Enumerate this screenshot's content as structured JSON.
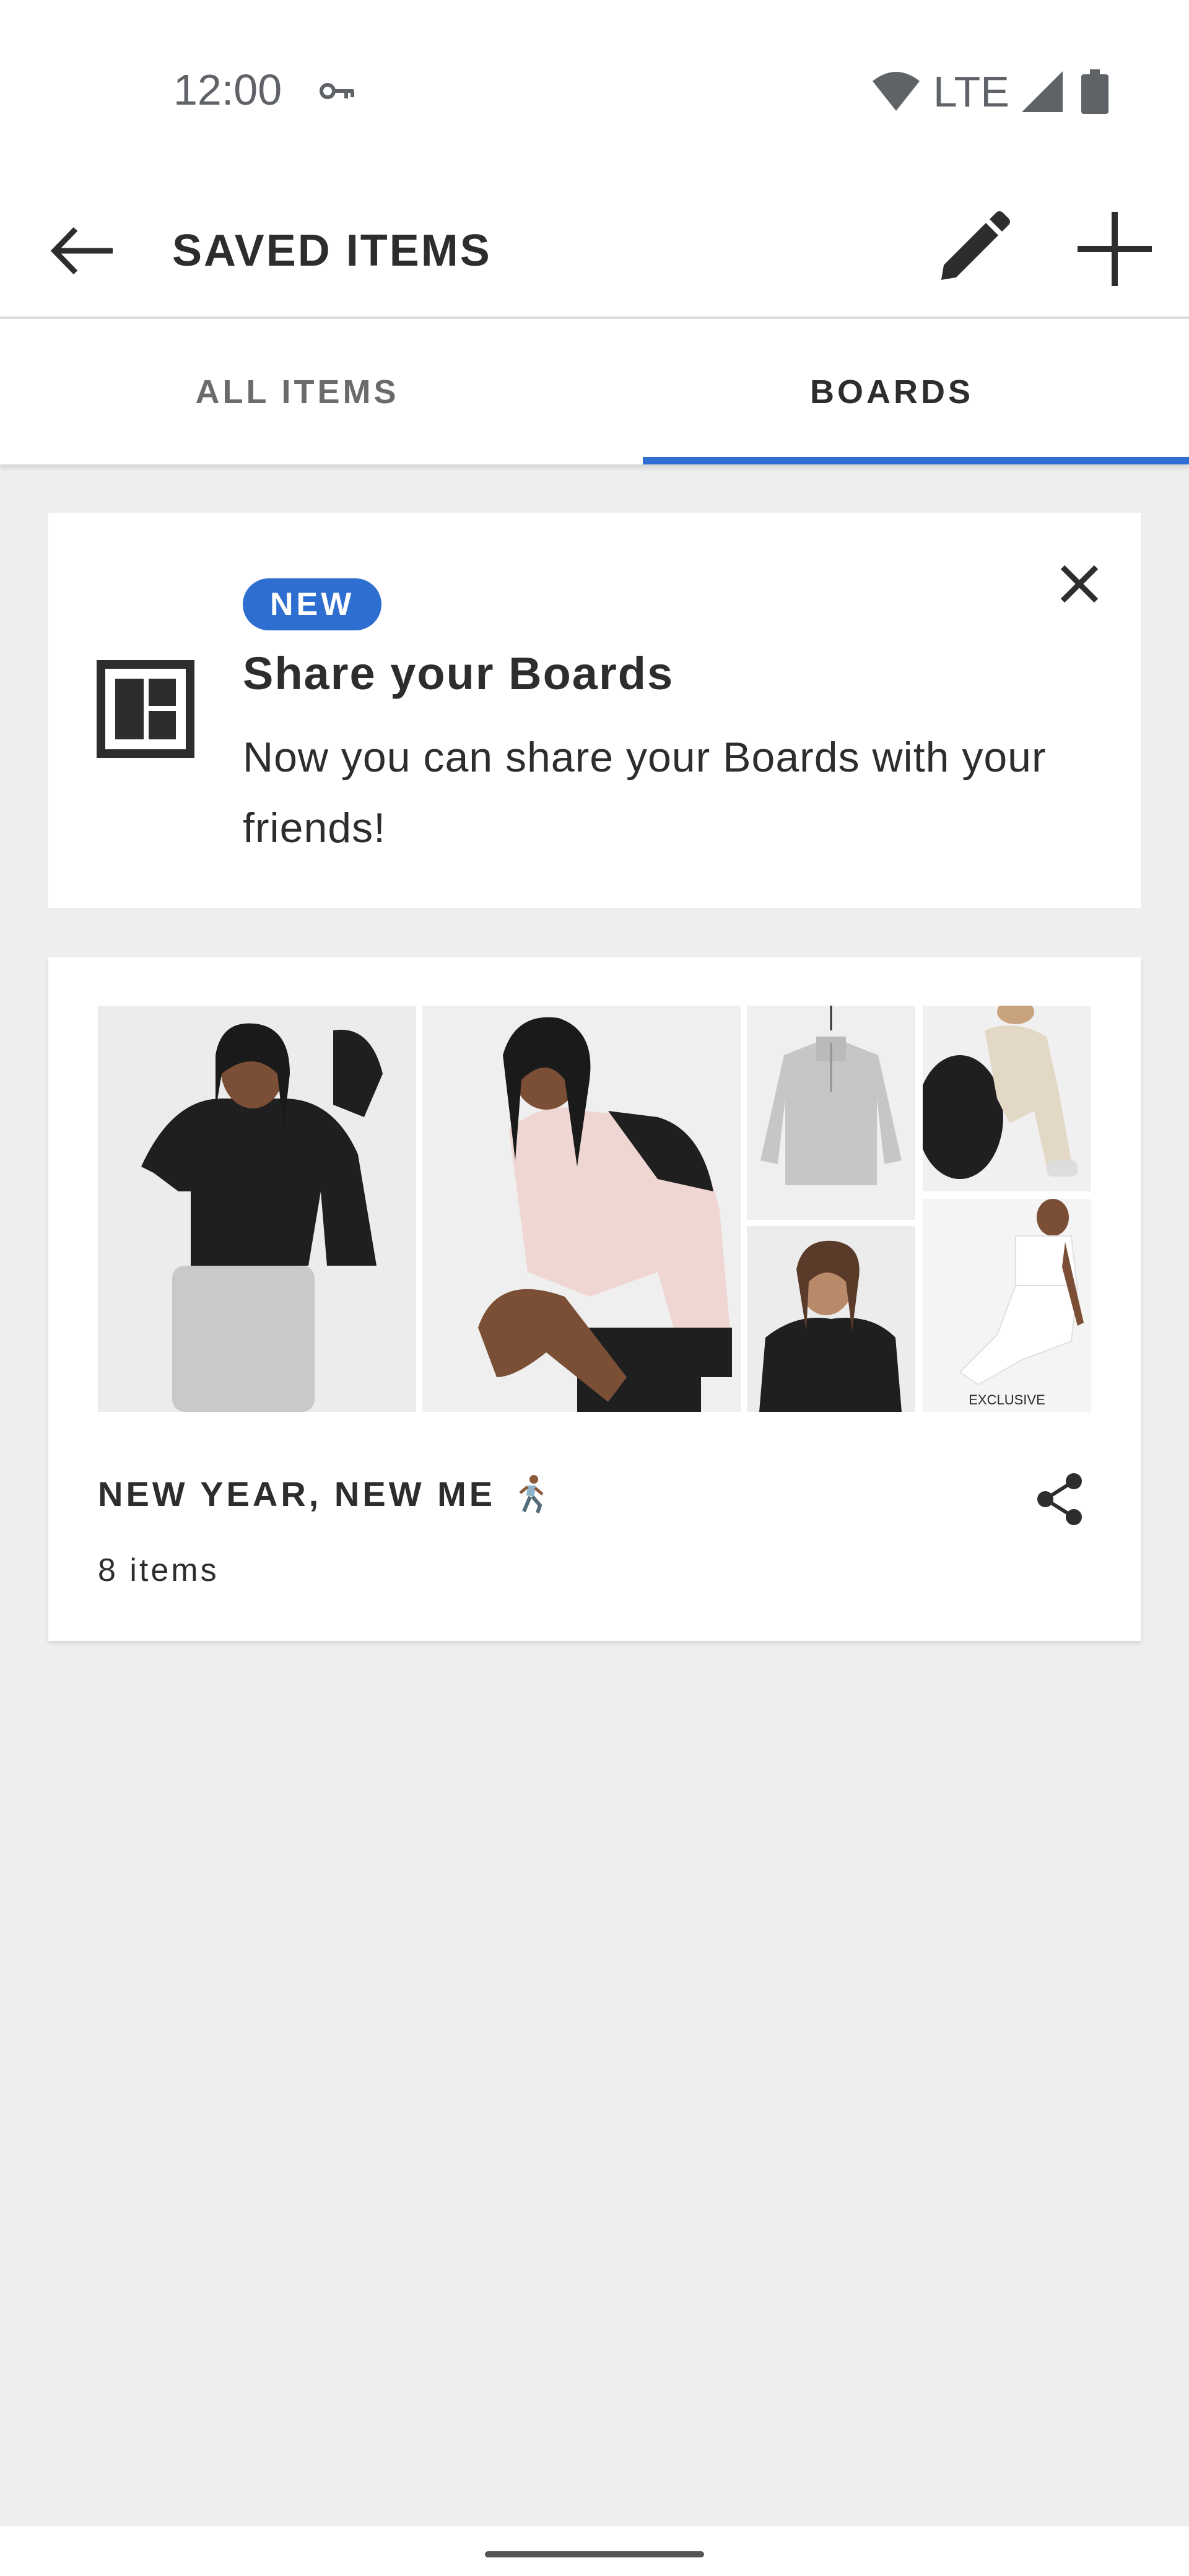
{
  "status_bar": {
    "time": "12:00",
    "network": "LTE",
    "icons": [
      "key-icon",
      "wifi-icon",
      "signal-icon",
      "battery-icon"
    ]
  },
  "app_bar": {
    "title": "SAVED ITEMS",
    "icons": [
      "back-arrow-icon",
      "pencil-icon",
      "plus-icon"
    ]
  },
  "tabs": [
    {
      "label": "ALL ITEMS",
      "active": false
    },
    {
      "label": "BOARDS",
      "active": true
    }
  ],
  "promo": {
    "badge": "NEW",
    "title": "Share your Boards",
    "body": "Now you can share your Boards with your friends!",
    "icons": [
      "boards-icon",
      "close-icon"
    ]
  },
  "board": {
    "name": "NEW YEAR, NEW ME",
    "item_count": "8 items",
    "photo_caption": "EXCLUSIVE",
    "icons": [
      "runner-emoji-icon",
      "share-icon"
    ]
  },
  "colors": {
    "accent": "#2d6ed0",
    "background": "#eeeeee",
    "surface": "#ffffff",
    "text_primary": "#2d2d2d",
    "text_secondary": "#6b6b6b",
    "status_text": "#5f6368"
  }
}
